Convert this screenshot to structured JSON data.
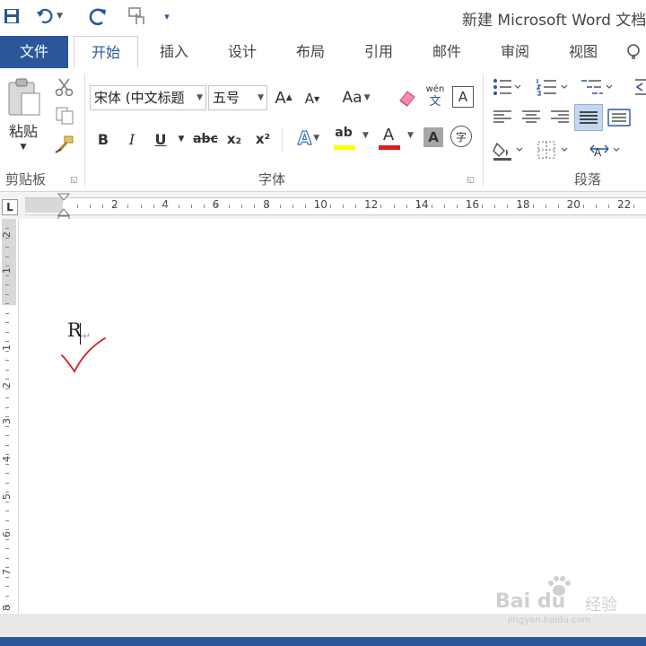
{
  "app": {
    "title": "新建 Microsoft Word 文档"
  },
  "quick_access": {
    "icons": [
      "save-icon",
      "undo-icon",
      "redo-icon",
      "touch-mode-icon",
      "customize-icon"
    ]
  },
  "tabs": [
    {
      "label": "文件"
    },
    {
      "label": "开始"
    },
    {
      "label": "插入"
    },
    {
      "label": "设计"
    },
    {
      "label": "布局"
    },
    {
      "label": "引用"
    },
    {
      "label": "邮件"
    },
    {
      "label": "审阅"
    },
    {
      "label": "视图"
    }
  ],
  "ribbon": {
    "clipboard": {
      "paste_label": "粘贴",
      "group_label": "剪贴板"
    },
    "font": {
      "font_name": "宋体 (中文标题",
      "font_size": "五号",
      "grow_label": "A",
      "shrink_label": "A",
      "case_label": "Aa",
      "phonetic_top": "wén",
      "phonetic_bottom": "文",
      "border_label": "A",
      "bold": "B",
      "italic": "I",
      "underline": "U",
      "strike": "abc",
      "subscript": "x₂",
      "superscript": "x²",
      "effects": "A",
      "highlight": "ab",
      "font_color": "A",
      "shading": "A",
      "enclose": "字",
      "group_label": "字体"
    },
    "paragraph": {
      "group_label": "段落"
    }
  },
  "ruler": {
    "marks": [
      "2",
      "4",
      "6",
      "8",
      "10",
      "12",
      "14",
      "16",
      "18",
      "20",
      "22"
    ],
    "vertical_marks": [
      "2",
      "1",
      "1",
      "2",
      "3",
      "4",
      "5",
      "6",
      "7",
      "8"
    ]
  },
  "document": {
    "text": "R"
  },
  "watermark": {
    "brand": "Bai du",
    "sub_brand": "经验",
    "url": "jingyan.baidu.com"
  },
  "colors": {
    "accent": "#2b579a",
    "pen": "#d42020"
  }
}
